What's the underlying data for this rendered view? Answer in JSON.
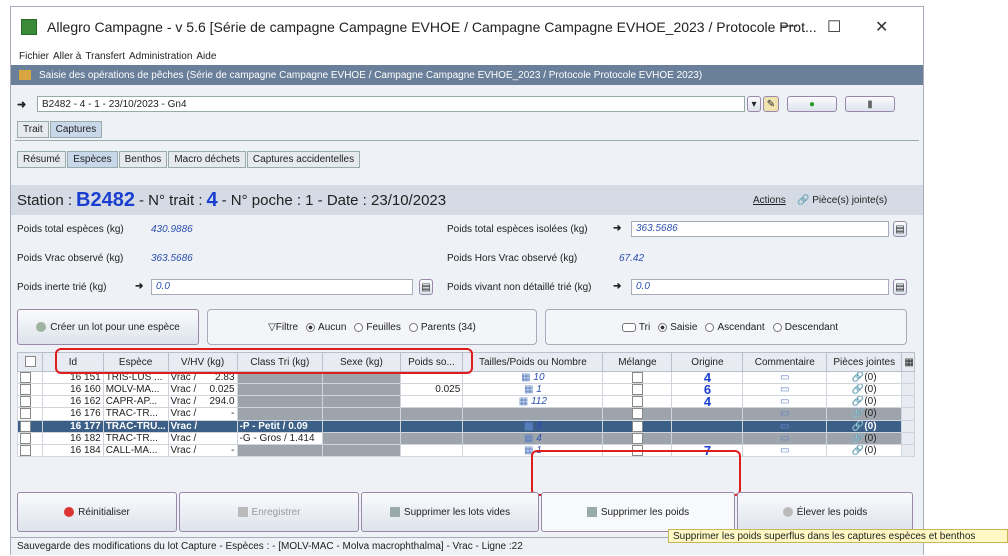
{
  "window": {
    "title": "Allegro Campagne - v 5.6 [Série de campagne Campagne EVHOE / Campagne Campagne EVHOE_2023 / Protocole Prot...",
    "minimize": "—",
    "maximize": "☐",
    "close": "✕"
  },
  "menu": [
    "Fichier",
    "Aller à",
    "Transfert",
    "Administration",
    "Aide"
  ],
  "frame_header": "Saisie des opérations de pêches (Série de campagne Campagne EVHOE / Campagne Campagne EVHOE_2023 / Protocole Protocole EVHOE 2023)",
  "operation_select": "B2482 - 4 - 1 - 23/10/2023 - Gn4",
  "top_tabs": [
    "Trait",
    "Captures"
  ],
  "sub_tabs": [
    "Résumé",
    "Espèces",
    "Benthos",
    "Macro déchets",
    "Captures accidentelles"
  ],
  "station": {
    "prefix": "Station :",
    "code": "B2482",
    "trait_label": "- N° trait :",
    "trait": "4",
    "rest": "- N° poche : 1 - Date : 23/10/2023",
    "actions": "Actions",
    "attachments": "Pièce(s) jointe(s)"
  },
  "fields": {
    "poids_total_label": "Poids total espèces (kg)",
    "poids_total": "430.9886",
    "poids_isolees_label": "Poids total espèces isolées (kg)",
    "poids_isolees": "363.5686",
    "poids_vrac_label": "Poids Vrac observé (kg)",
    "poids_vrac": "363.5686",
    "poids_hors_vrac_label": "Poids Hors Vrac observé (kg)",
    "poids_hors_vrac": "67.42",
    "poids_inerte_label": "Poids inerte trié (kg)",
    "poids_inerte": "0.0",
    "poids_vivant_label": "Poids vivant non détaillé trié (kg)",
    "poids_vivant": "0.0"
  },
  "create_lot_button": "Créer un lot pour une espèce",
  "filter": {
    "label": "Filtre",
    "options": [
      "Aucun",
      "Feuilles",
      "Parents (34)"
    ]
  },
  "sort": {
    "options": [
      "Tri",
      "Saisie",
      "Ascendant",
      "Descendant"
    ]
  },
  "table": {
    "headers": [
      "Id",
      "Espèce",
      "V/HV (kg)",
      "Class Tri (kg)",
      "Sexe (kg)",
      "Poids so...",
      "Tailles/Poids ou Nombre",
      "Mélange",
      "Origine",
      "Commentaire",
      "Pièces jointes"
    ],
    "rows": [
      {
        "id": "16 151",
        "espece": "TRIS-LUS ...",
        "vhv": "Vrac /",
        "vhv_val": "2.83",
        "classe": "",
        "sexe": "",
        "poids": "",
        "taille": "10",
        "origine": "4",
        "pj": "(0)"
      },
      {
        "id": "16 160",
        "espece": "MOLV-MA...",
        "vhv": "Vrac /",
        "vhv_val": "0.025",
        "classe": "",
        "sexe": "",
        "poids": "0.025",
        "taille": "1",
        "origine": "6",
        "pj": "(0)"
      },
      {
        "id": "16 162",
        "espece": "CAPR-AP...",
        "vhv": "Vrac /",
        "vhv_val": "294.0",
        "classe": "",
        "sexe": "",
        "poids": "",
        "taille": "112",
        "origine": "4",
        "pj": "(0)"
      },
      {
        "id": "16 176",
        "espece": "TRAC-TR...",
        "vhv": "Vrac /",
        "vhv_val": "-",
        "classe": "",
        "sexe": "",
        "poids": "",
        "taille": "",
        "origine": "",
        "pj": "(0)"
      },
      {
        "id": "16 177",
        "espece": "TRAC-TRU...",
        "vhv": "Vrac /",
        "vhv_val": "",
        "classe": "-P - Petit /  0.09",
        "sexe": "",
        "poids": "",
        "taille": "5",
        "origine": "",
        "pj": "(0)"
      },
      {
        "id": "16 182",
        "espece": "TRAC-TR...",
        "vhv": "Vrac /",
        "vhv_val": "",
        "classe": "-G - Gros / 1.414",
        "sexe": "",
        "poids": "",
        "taille": "4",
        "origine": "",
        "pj": "(0)"
      },
      {
        "id": "16 184",
        "espece": "CALL-MA...",
        "vhv": "Vrac /",
        "vhv_val": "-",
        "classe": "",
        "sexe": "",
        "poids": "",
        "taille": "1",
        "origine": "7",
        "pj": "(0)"
      }
    ]
  },
  "buttons": {
    "reset": "Réinitialiser",
    "save": "Enregistrer",
    "delete_empty": "Supprimer les lots vides",
    "delete_weights": "Supprimer les poids",
    "raise_weights": "Élever les poids"
  },
  "status": "Sauvegarde des modifications du lot Capture - Espèces : - [MOLV-MAC - Molva macrophthalma] - Vrac - Ligne :22",
  "tooltip": "Supprimer les poids superflus dans les captures espèces et benthos",
  "colors": {
    "accent": "#1a3fd0",
    "selected_row": "#3b5f86",
    "highlight": "#e01d1d"
  }
}
